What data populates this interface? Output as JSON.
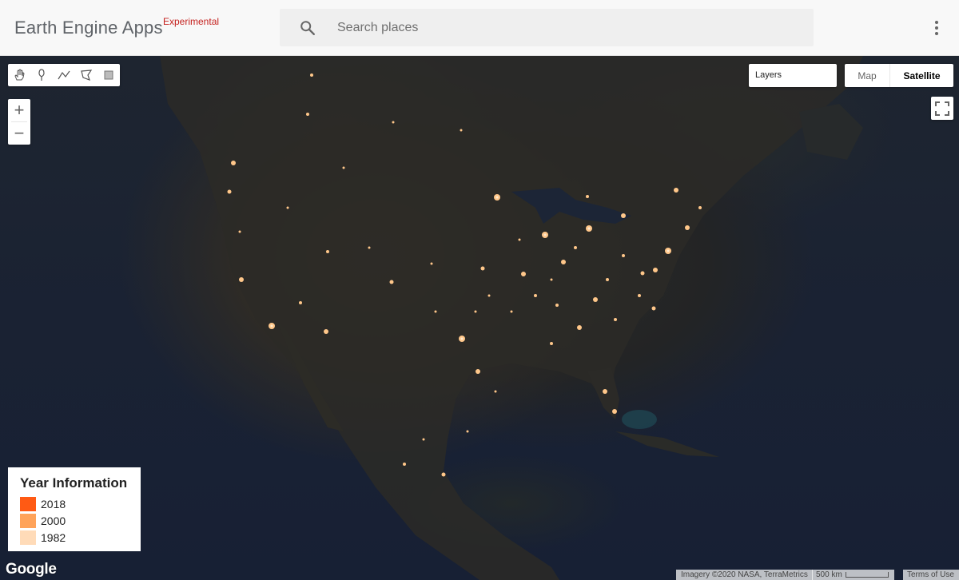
{
  "header": {
    "title": "Earth Engine Apps",
    "tag": "Experimental",
    "search": {
      "placeholder": "Search places",
      "value": ""
    },
    "icons": {
      "search": "search-icon",
      "menu": "more-vert-icon"
    }
  },
  "toolbar": {
    "tools": [
      "hand-pan-icon",
      "point-marker-icon",
      "polyline-icon",
      "polygon-icon",
      "rectangle-icon"
    ]
  },
  "zoom": {
    "in_label": "+",
    "out_label": "−"
  },
  "layers": {
    "label": "Layers"
  },
  "map_type": {
    "map_label": "Map",
    "satellite_label": "Satellite",
    "selected": "Satellite"
  },
  "legend": {
    "title": "Year Information",
    "items": [
      {
        "label": "2018",
        "color": "#ff5a14"
      },
      {
        "label": "2000",
        "color": "#ffa35a"
      },
      {
        "label": "1982",
        "color": "#ffdbb8"
      }
    ]
  },
  "footer": {
    "logo": "Google",
    "attribution": "Imagery ©2020 NASA, TerraMetrics",
    "scale_label": "500 km",
    "terms": "Terms of Use"
  },
  "colors": {
    "city_light": "#ffb266",
    "ocean": "#1a2233",
    "land": "#2f2d29"
  }
}
